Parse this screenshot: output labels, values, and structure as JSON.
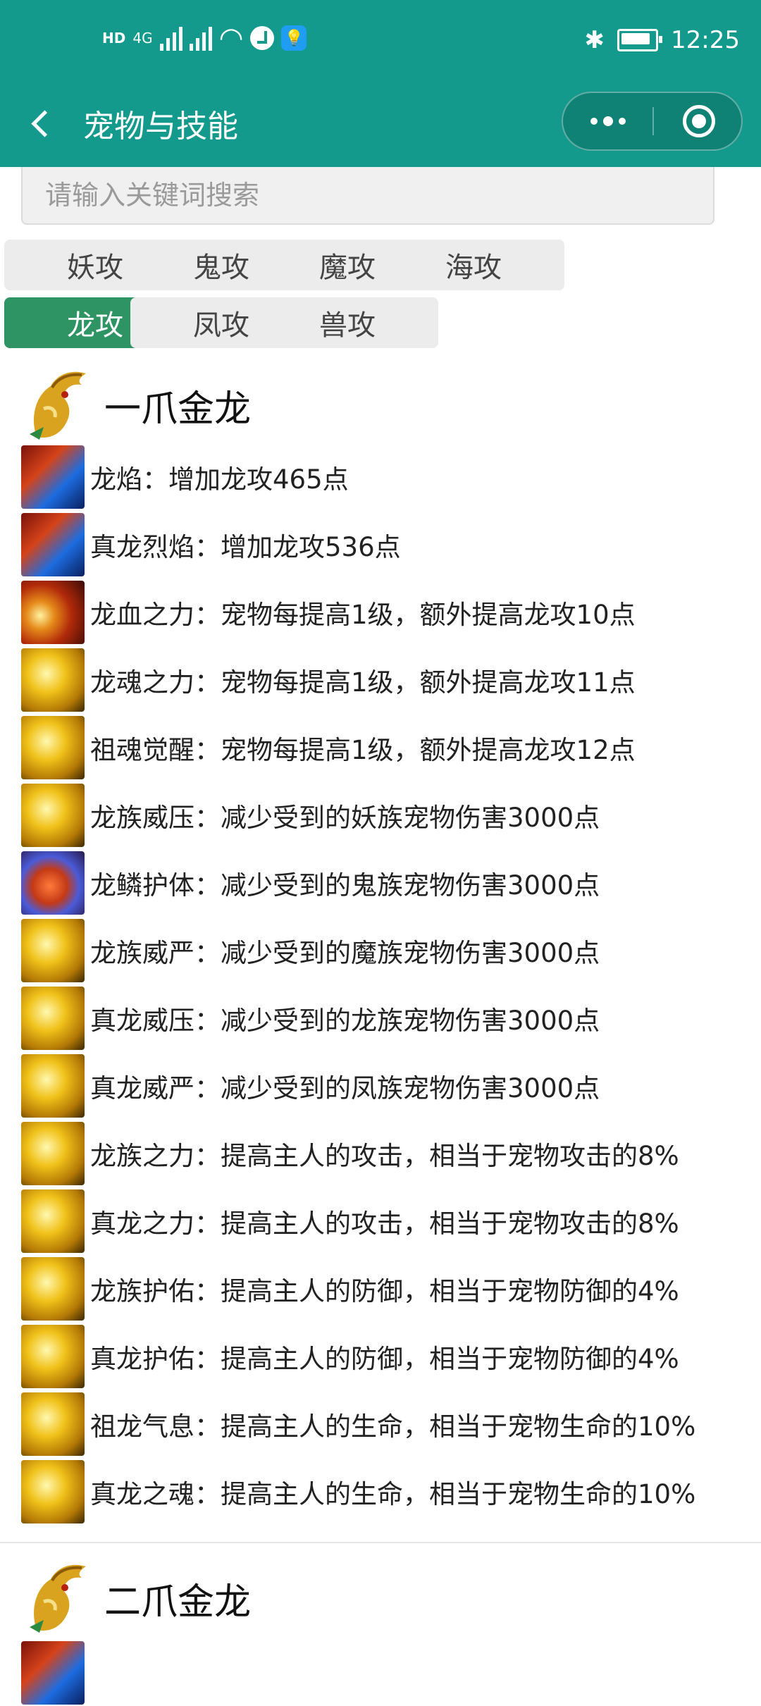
{
  "status_bar": {
    "hd_label": "HD",
    "network_label": "4G",
    "time": "12:25"
  },
  "nav": {
    "title": "宠物与技能"
  },
  "search": {
    "placeholder": "请输入关键词搜索",
    "value": ""
  },
  "tabs": [
    {
      "label": "妖攻",
      "active": false
    },
    {
      "label": "鬼攻",
      "active": false
    },
    {
      "label": "魔攻",
      "active": false
    },
    {
      "label": "海攻",
      "active": false
    },
    {
      "label": "龙攻",
      "active": true
    },
    {
      "label": "凤攻",
      "active": false
    },
    {
      "label": "兽攻",
      "active": false
    }
  ],
  "pets": [
    {
      "name": "一爪金龙",
      "skills": [
        {
          "text": "龙焰：增加龙攻465点",
          "icon": "flame-skill-icon"
        },
        {
          "text": "真龙烈焰：增加龙攻536点",
          "icon": "flame-skill-icon"
        },
        {
          "text": "龙血之力：宠物每提高1级，额外提高龙攻10点",
          "icon": "blood-skill-icon"
        },
        {
          "text": "龙魂之力：宠物每提高1级，额外提高龙攻11点",
          "icon": "gold-dragon-skill-icon"
        },
        {
          "text": "祖魂觉醒：宠物每提高1级，额外提高龙攻12点",
          "icon": "gold-dragon-skill-icon"
        },
        {
          "text": "龙族威压：减少受到的妖族宠物伤害3000点",
          "icon": "gold-dragon-skill-icon"
        },
        {
          "text": "龙鳞护体：减少受到的鬼族宠物伤害3000点",
          "icon": "scale-skill-icon"
        },
        {
          "text": "龙族威严：减少受到的魔族宠物伤害3000点",
          "icon": "gold-dragon-skill-icon"
        },
        {
          "text": "真龙威压：减少受到的龙族宠物伤害3000点",
          "icon": "gold-dragon-skill-icon"
        },
        {
          "text": "真龙威严：减少受到的凤族宠物伤害3000点",
          "icon": "gold-dragon-skill-icon"
        },
        {
          "text": "龙族之力：提高主人的攻击，相当于宠物攻击的8%",
          "icon": "gold-dragon-skill-icon"
        },
        {
          "text": "真龙之力：提高主人的攻击，相当于宠物攻击的8%",
          "icon": "gold-dragon-skill-icon"
        },
        {
          "text": "龙族护佑：提高主人的防御，相当于宠物防御的4%",
          "icon": "gold-dragon-skill-icon"
        },
        {
          "text": "真龙护佑：提高主人的防御，相当于宠物防御的4%",
          "icon": "gold-dragon-skill-icon"
        },
        {
          "text": "祖龙气息：提高主人的生命，相当于宠物生命的10%",
          "icon": "gold-dragon-skill-icon"
        },
        {
          "text": "真龙之魂：提高主人的生命，相当于宠物生命的10%",
          "icon": "gold-dragon-skill-icon"
        }
      ]
    },
    {
      "name": "二爪金龙",
      "skills": [
        {
          "text": "",
          "icon": "flame-skill-icon"
        }
      ]
    }
  ]
}
